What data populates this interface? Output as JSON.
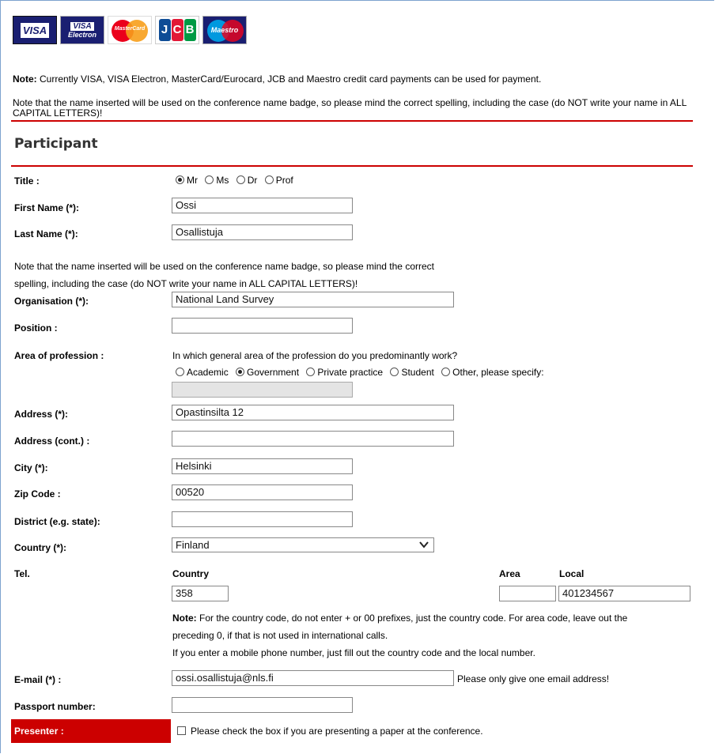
{
  "cards": {
    "visa": "VISA",
    "electron_top": "VISA",
    "electron_bottom": "Electron",
    "mastercard": "MasterCard",
    "jcb": [
      "J",
      "C",
      "B"
    ],
    "maestro": "Maestro"
  },
  "notes": {
    "note_label": "Note:",
    "payment": " Currently VISA, VISA Electron, MasterCard/Eurocard, JCB and Maestro credit card payments can be used for payment.",
    "name_badge": "Note that the name inserted will be used on the conference name badge, so please mind the correct spelling, including the case (do NOT write your name in ALL CAPITAL LETTERS)!"
  },
  "section_title": "Participant",
  "fields": {
    "title_label": "Title :",
    "title_options": [
      "Mr",
      "Ms",
      "Dr",
      "Prof"
    ],
    "title_selected": "Mr",
    "first_name_label": "First Name (*):",
    "first_name": "Ossi",
    "last_name_label": "Last Name (*):",
    "last_name": "Osallistuja",
    "name_note_line1": "Note that the name inserted will be used on the conference name badge, so please mind the correct",
    "name_note_line2": "spelling, including the case (do NOT write your name in ALL CAPITAL LETTERS)!",
    "organisation_label": "Organisation (*):",
    "organisation": "National Land Survey",
    "position_label": "Position :",
    "position": "",
    "area_label": "Area of profession :",
    "area_question": "In which general area of the profession do you predominantly work?",
    "area_options": [
      "Academic",
      "Government",
      "Private practice",
      "Student",
      "Other, please specify:"
    ],
    "area_selected": "Government",
    "address_label": "Address (*):",
    "address": "Opastinsilta 12",
    "address2_label": "Address (cont.) :",
    "address2": "",
    "city_label": "City (*):",
    "city": "Helsinki",
    "zip_label": "Zip Code :",
    "zip": "00520",
    "district_label": "District (e.g. state):",
    "district": "",
    "country_label": "Country (*):",
    "country": "Finland",
    "tel_label": "Tel.",
    "tel_country_header": "Country",
    "tel_area_header": "Area",
    "tel_local_header": "Local",
    "tel_country": "358",
    "tel_area": "",
    "tel_local": "401234567",
    "tel_note_label": "Note:",
    "tel_note_1": " For the country code, do not enter + or 00 prefixes, just the country code. For area code, leave out the",
    "tel_note_2": "preceding 0, if that is not used in international calls.",
    "tel_note_3": "If you enter a mobile phone number, just fill out the country code and the local number.",
    "email_label": "E-mail (*) :",
    "email": "ossi.osallistuja@nls.fi",
    "email_hint": "Please only give one email address!",
    "passport_label": "Passport number:",
    "passport": "",
    "presenter_label": "Presenter :",
    "presenter_text": "Please check the box if you are presenting a paper at the conference."
  },
  "colors": {
    "accent_red": "#cc0000",
    "visa_blue": "#1a1f71"
  }
}
